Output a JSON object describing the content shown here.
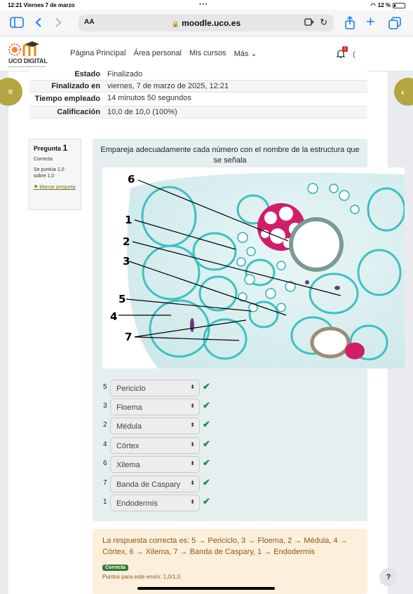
{
  "status_bar": {
    "time": "12:21  Viernes 7 de marzo",
    "dots": "•••",
    "battery": "12 %"
  },
  "browser": {
    "text_size_label": "AA",
    "url": "moodle.uco.es"
  },
  "navbar": {
    "logo_text": "UCO DIGITAL",
    "logo_subtext": "CENTRO DE RECURSOS VIRTUALES",
    "links": [
      "Página Principal",
      "Área personal",
      "Mis cursos",
      "Más ⌄"
    ],
    "notification_count": "1",
    "user_fragment": "("
  },
  "summary": [
    {
      "key": "Estado",
      "value": "Finalizado"
    },
    {
      "key": "Finalizado en",
      "value": "viernes, 7 de marzo de 2025, 12:21"
    },
    {
      "key": "Tiempo empleado",
      "value": "14 minutos 50 segundos"
    },
    {
      "key": "Calificación",
      "value": "10,0 de 10,0 (100%)"
    }
  ],
  "question_info": {
    "label": "Pregunta",
    "number": "1",
    "state": "Correcta",
    "grade": "Se puntúa 1,0 sobre 1,0",
    "flag": "Marcar pregunta"
  },
  "question": {
    "text": "Empareja adecuadamente cada número con el nombre de la estructura que se señala",
    "figure_labels": [
      "6",
      "1",
      "2",
      "3",
      "5",
      "4",
      "7"
    ],
    "answers": [
      {
        "num": "5",
        "selected": "Periciclo"
      },
      {
        "num": "3",
        "selected": "Floema"
      },
      {
        "num": "2",
        "selected": "Médula"
      },
      {
        "num": "4",
        "selected": "Córtex"
      },
      {
        "num": "6",
        "selected": "Xilema"
      },
      {
        "num": "7",
        "selected": "Banda de Caspary"
      },
      {
        "num": "1",
        "selected": "Endodermis"
      }
    ]
  },
  "feedback": {
    "text": "La respuesta correcta es: 5 → Periciclo, 3 → Floema, 2 → Médula, 4 → Córtex, 6 → Xilema, 7 → Banda de Caspary, 1 → Endodermis",
    "badge": "Correcta",
    "points": "Puntos para este envío: 1,0/1,0."
  },
  "help_label": "?",
  "colors": {
    "accent": "#b3a640",
    "panel": "#e6eff0",
    "feedback_bg": "#fcefdc",
    "correct": "#357a32"
  }
}
